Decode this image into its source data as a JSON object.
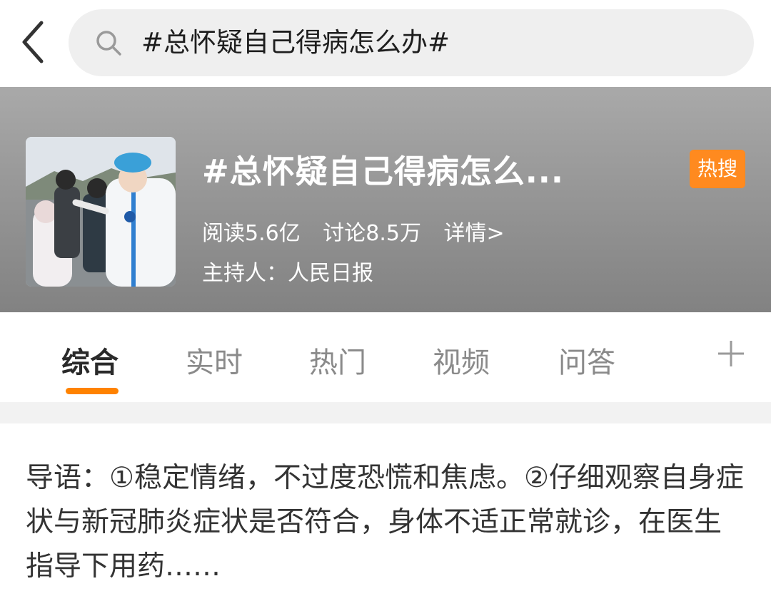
{
  "search": {
    "query": "#总怀疑自己得病怎么办#"
  },
  "topic": {
    "title": "#总怀疑自己得病怎么...",
    "badge": "热搜",
    "reads": "阅读5.6亿",
    "discussions": "讨论8.5万",
    "details_link": "详情>",
    "host": "主持人：人民日报"
  },
  "tabs": [
    {
      "label": "综合",
      "active": true
    },
    {
      "label": "实时"
    },
    {
      "label": "热门"
    },
    {
      "label": "视频"
    },
    {
      "label": "问答"
    }
  ],
  "intro": {
    "text": "导语：①稳定情绪，不过度恐慌和焦虑。②仔细观察自身症状与新冠肺炎症状是否符合，身体不适正常就诊，在医生指导下用药……"
  },
  "colors": {
    "accent": "#ff8200",
    "badge": "#ff8a1f"
  },
  "icons": [
    "back-arrow-icon",
    "search-icon",
    "plus-icon"
  ]
}
